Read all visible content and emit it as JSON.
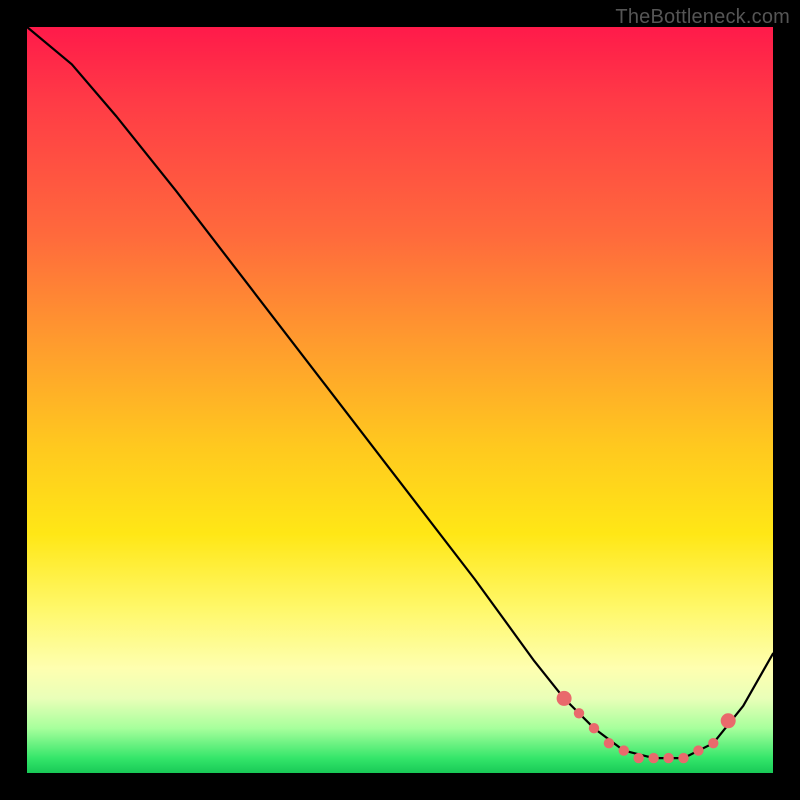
{
  "watermark": "TheBottleneck.com",
  "chart_data": {
    "type": "line",
    "title": "",
    "xlabel": "",
    "ylabel": "",
    "xlim": [
      0,
      100
    ],
    "ylim": [
      0,
      100
    ],
    "grid": false,
    "legend": false,
    "background_gradient": [
      "#ff1a4a",
      "#ff9a2e",
      "#ffe716",
      "#feffb0",
      "#18c957"
    ],
    "series": [
      {
        "name": "bottleneck-curve",
        "color": "#000000",
        "x": [
          0,
          6,
          12,
          20,
          30,
          40,
          50,
          60,
          68,
          72,
          76,
          80,
          84,
          88,
          92,
          96,
          100
        ],
        "y": [
          100,
          95,
          88,
          78,
          65,
          52,
          39,
          26,
          15,
          10,
          6,
          3,
          2,
          2,
          4,
          9,
          16
        ]
      }
    ],
    "markers": {
      "name": "highlighted-points",
      "color": "#e96a6c",
      "x": [
        72,
        74,
        76,
        78,
        80,
        82,
        84,
        86,
        88,
        90,
        92,
        94
      ],
      "y": [
        10,
        8,
        6,
        4,
        3,
        2,
        2,
        2,
        2,
        3,
        4,
        7
      ]
    }
  }
}
